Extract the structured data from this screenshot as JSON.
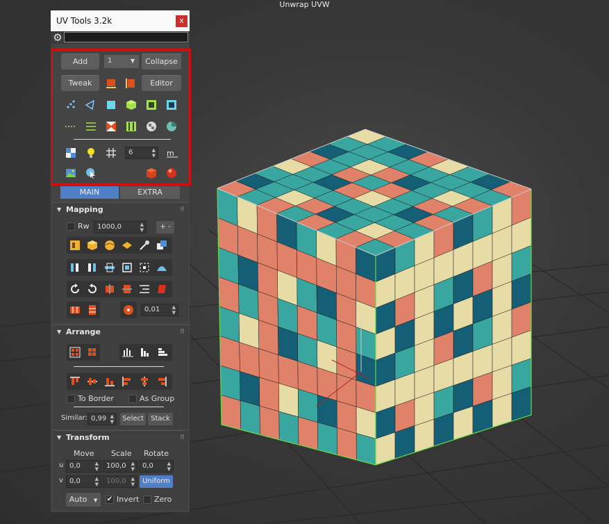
{
  "viewport": {
    "title": "Unwrap UVW"
  },
  "panel": {
    "title": "UV Tools 3.2k",
    "close_label": "x",
    "search_placeholder": "",
    "top": {
      "add_label": "Add",
      "channel_value": "1",
      "collapse_label": "Collapse",
      "tweak_label": "Tweak",
      "editor_label": "Editor",
      "checker_value": "6"
    },
    "tabs": {
      "main": "MAIN",
      "extra": "EXTRA"
    },
    "mapping": {
      "title": "Mapping",
      "rw_label": "Rw",
      "rw_value": "1000,0",
      "plus_minus": "+ -",
      "spin_value": "0,01"
    },
    "arrange": {
      "title": "Arrange",
      "to_border_label": "To Border",
      "as_group_label": "As Group",
      "similar_label": "Similar:",
      "similar_value": "0,99",
      "select_label": "Select",
      "stack_label": "Stack"
    },
    "transform": {
      "title": "Transform",
      "move_label": "Move",
      "scale_label": "Scale",
      "rotate_label": "Rotate",
      "u_label": "u",
      "v_label": "v",
      "u_move": "0,0",
      "u_scale": "100,0",
      "u_rotate": "0,0",
      "v_move": "0,0",
      "v_scale": "100,0",
      "uniform_label": "Uniform",
      "auto_label": "Auto",
      "invert_label": "Invert",
      "zero_label": "Zero",
      "invert_checked": "✔"
    }
  },
  "colors": {
    "teal": "#3aa6a0",
    "dark_teal": "#145f75",
    "salmon": "#e0826a",
    "cream": "#e8dca6",
    "highlight": "#d01010",
    "accent_blue": "#4f7fc4"
  }
}
